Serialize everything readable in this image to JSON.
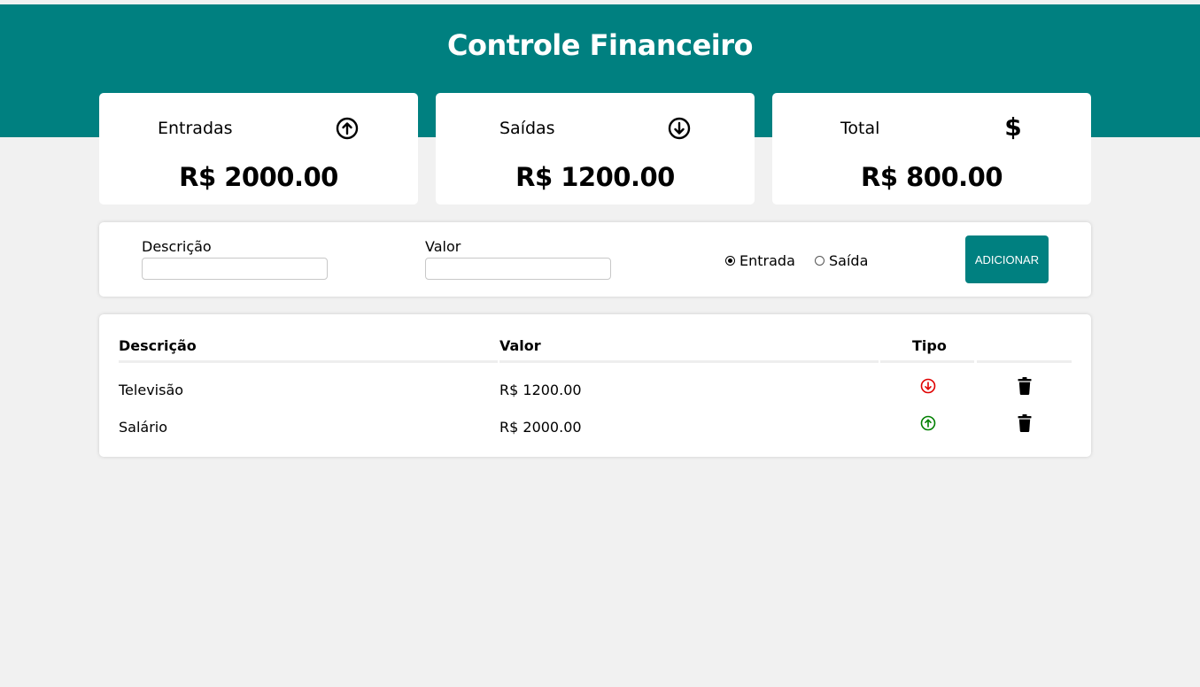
{
  "header": {
    "title": "Controle Financeiro"
  },
  "summary": {
    "entradas": {
      "label": "Entradas",
      "icon": "arrow-circle-up-icon",
      "value": "R$ 2000.00"
    },
    "saidas": {
      "label": "Saídas",
      "icon": "arrow-circle-down-icon",
      "value": "R$ 1200.00"
    },
    "total": {
      "label": "Total",
      "icon": "dollar-icon",
      "symbol": "$",
      "value": "R$ 800.00"
    }
  },
  "form": {
    "descricao_label": "Descrição",
    "descricao_value": "",
    "valor_label": "Valor",
    "valor_value": "",
    "radio_entrada": "Entrada",
    "radio_saida": "Saída",
    "selected": "Entrada",
    "button": "ADICIONAR"
  },
  "table": {
    "headers": [
      "Descrição",
      "Valor",
      "Tipo",
      ""
    ],
    "rows": [
      {
        "descricao": "Televisão",
        "valor": "R$ 1200.00",
        "tipo": "saida",
        "tipo_icon": "arrow-circle-down-icon",
        "tipo_color": "#e00000",
        "action_icon": "trash-icon"
      },
      {
        "descricao": "Salário",
        "valor": "R$ 2000.00",
        "tipo": "entrada",
        "tipo_icon": "arrow-circle-up-icon",
        "tipo_color": "#008000",
        "action_icon": "trash-icon"
      }
    ]
  },
  "colors": {
    "brand": "#008080",
    "background": "#f1f1f1",
    "entrada": "#008000",
    "saida": "#e00000"
  }
}
